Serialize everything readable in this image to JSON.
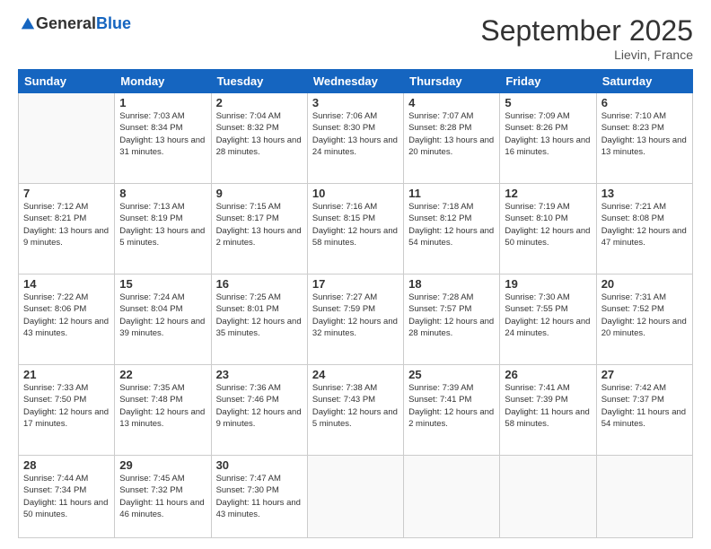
{
  "logo": {
    "general": "General",
    "blue": "Blue"
  },
  "header": {
    "month": "September 2025",
    "location": "Lievin, France"
  },
  "days_of_week": [
    "Sunday",
    "Monday",
    "Tuesday",
    "Wednesday",
    "Thursday",
    "Friday",
    "Saturday"
  ],
  "weeks": [
    [
      {
        "day": "",
        "info": ""
      },
      {
        "day": "1",
        "info": "Sunrise: 7:03 AM\nSunset: 8:34 PM\nDaylight: 13 hours and 31 minutes."
      },
      {
        "day": "2",
        "info": "Sunrise: 7:04 AM\nSunset: 8:32 PM\nDaylight: 13 hours and 28 minutes."
      },
      {
        "day": "3",
        "info": "Sunrise: 7:06 AM\nSunset: 8:30 PM\nDaylight: 13 hours and 24 minutes."
      },
      {
        "day": "4",
        "info": "Sunrise: 7:07 AM\nSunset: 8:28 PM\nDaylight: 13 hours and 20 minutes."
      },
      {
        "day": "5",
        "info": "Sunrise: 7:09 AM\nSunset: 8:26 PM\nDaylight: 13 hours and 16 minutes."
      },
      {
        "day": "6",
        "info": "Sunrise: 7:10 AM\nSunset: 8:23 PM\nDaylight: 13 hours and 13 minutes."
      }
    ],
    [
      {
        "day": "7",
        "info": "Sunrise: 7:12 AM\nSunset: 8:21 PM\nDaylight: 13 hours and 9 minutes."
      },
      {
        "day": "8",
        "info": "Sunrise: 7:13 AM\nSunset: 8:19 PM\nDaylight: 13 hours and 5 minutes."
      },
      {
        "day": "9",
        "info": "Sunrise: 7:15 AM\nSunset: 8:17 PM\nDaylight: 13 hours and 2 minutes."
      },
      {
        "day": "10",
        "info": "Sunrise: 7:16 AM\nSunset: 8:15 PM\nDaylight: 12 hours and 58 minutes."
      },
      {
        "day": "11",
        "info": "Sunrise: 7:18 AM\nSunset: 8:12 PM\nDaylight: 12 hours and 54 minutes."
      },
      {
        "day": "12",
        "info": "Sunrise: 7:19 AM\nSunset: 8:10 PM\nDaylight: 12 hours and 50 minutes."
      },
      {
        "day": "13",
        "info": "Sunrise: 7:21 AM\nSunset: 8:08 PM\nDaylight: 12 hours and 47 minutes."
      }
    ],
    [
      {
        "day": "14",
        "info": "Sunrise: 7:22 AM\nSunset: 8:06 PM\nDaylight: 12 hours and 43 minutes."
      },
      {
        "day": "15",
        "info": "Sunrise: 7:24 AM\nSunset: 8:04 PM\nDaylight: 12 hours and 39 minutes."
      },
      {
        "day": "16",
        "info": "Sunrise: 7:25 AM\nSunset: 8:01 PM\nDaylight: 12 hours and 35 minutes."
      },
      {
        "day": "17",
        "info": "Sunrise: 7:27 AM\nSunset: 7:59 PM\nDaylight: 12 hours and 32 minutes."
      },
      {
        "day": "18",
        "info": "Sunrise: 7:28 AM\nSunset: 7:57 PM\nDaylight: 12 hours and 28 minutes."
      },
      {
        "day": "19",
        "info": "Sunrise: 7:30 AM\nSunset: 7:55 PM\nDaylight: 12 hours and 24 minutes."
      },
      {
        "day": "20",
        "info": "Sunrise: 7:31 AM\nSunset: 7:52 PM\nDaylight: 12 hours and 20 minutes."
      }
    ],
    [
      {
        "day": "21",
        "info": "Sunrise: 7:33 AM\nSunset: 7:50 PM\nDaylight: 12 hours and 17 minutes."
      },
      {
        "day": "22",
        "info": "Sunrise: 7:35 AM\nSunset: 7:48 PM\nDaylight: 12 hours and 13 minutes."
      },
      {
        "day": "23",
        "info": "Sunrise: 7:36 AM\nSunset: 7:46 PM\nDaylight: 12 hours and 9 minutes."
      },
      {
        "day": "24",
        "info": "Sunrise: 7:38 AM\nSunset: 7:43 PM\nDaylight: 12 hours and 5 minutes."
      },
      {
        "day": "25",
        "info": "Sunrise: 7:39 AM\nSunset: 7:41 PM\nDaylight: 12 hours and 2 minutes."
      },
      {
        "day": "26",
        "info": "Sunrise: 7:41 AM\nSunset: 7:39 PM\nDaylight: 11 hours and 58 minutes."
      },
      {
        "day": "27",
        "info": "Sunrise: 7:42 AM\nSunset: 7:37 PM\nDaylight: 11 hours and 54 minutes."
      }
    ],
    [
      {
        "day": "28",
        "info": "Sunrise: 7:44 AM\nSunset: 7:34 PM\nDaylight: 11 hours and 50 minutes."
      },
      {
        "day": "29",
        "info": "Sunrise: 7:45 AM\nSunset: 7:32 PM\nDaylight: 11 hours and 46 minutes."
      },
      {
        "day": "30",
        "info": "Sunrise: 7:47 AM\nSunset: 7:30 PM\nDaylight: 11 hours and 43 minutes."
      },
      {
        "day": "",
        "info": ""
      },
      {
        "day": "",
        "info": ""
      },
      {
        "day": "",
        "info": ""
      },
      {
        "day": "",
        "info": ""
      }
    ]
  ]
}
